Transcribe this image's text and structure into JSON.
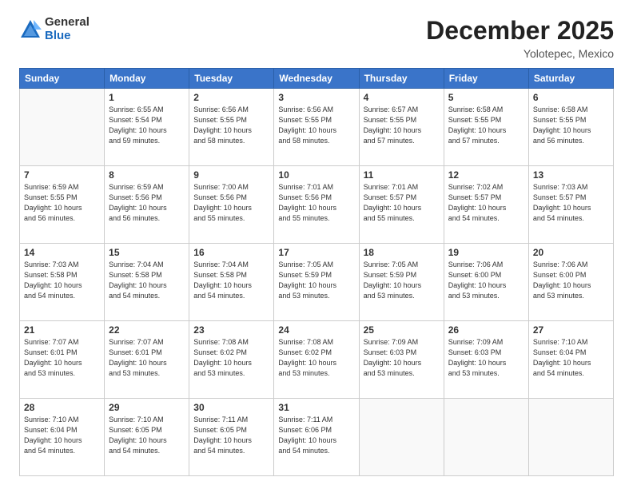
{
  "logo": {
    "general": "General",
    "blue": "Blue"
  },
  "title": "December 2025",
  "subtitle": "Yolotepec, Mexico",
  "weekdays": [
    "Sunday",
    "Monday",
    "Tuesday",
    "Wednesday",
    "Thursday",
    "Friday",
    "Saturday"
  ],
  "weeks": [
    [
      {
        "day": "",
        "info": ""
      },
      {
        "day": "1",
        "info": "Sunrise: 6:55 AM\nSunset: 5:54 PM\nDaylight: 10 hours\nand 59 minutes."
      },
      {
        "day": "2",
        "info": "Sunrise: 6:56 AM\nSunset: 5:55 PM\nDaylight: 10 hours\nand 58 minutes."
      },
      {
        "day": "3",
        "info": "Sunrise: 6:56 AM\nSunset: 5:55 PM\nDaylight: 10 hours\nand 58 minutes."
      },
      {
        "day": "4",
        "info": "Sunrise: 6:57 AM\nSunset: 5:55 PM\nDaylight: 10 hours\nand 57 minutes."
      },
      {
        "day": "5",
        "info": "Sunrise: 6:58 AM\nSunset: 5:55 PM\nDaylight: 10 hours\nand 57 minutes."
      },
      {
        "day": "6",
        "info": "Sunrise: 6:58 AM\nSunset: 5:55 PM\nDaylight: 10 hours\nand 56 minutes."
      }
    ],
    [
      {
        "day": "7",
        "info": "Sunrise: 6:59 AM\nSunset: 5:55 PM\nDaylight: 10 hours\nand 56 minutes."
      },
      {
        "day": "8",
        "info": "Sunrise: 6:59 AM\nSunset: 5:56 PM\nDaylight: 10 hours\nand 56 minutes."
      },
      {
        "day": "9",
        "info": "Sunrise: 7:00 AM\nSunset: 5:56 PM\nDaylight: 10 hours\nand 55 minutes."
      },
      {
        "day": "10",
        "info": "Sunrise: 7:01 AM\nSunset: 5:56 PM\nDaylight: 10 hours\nand 55 minutes."
      },
      {
        "day": "11",
        "info": "Sunrise: 7:01 AM\nSunset: 5:57 PM\nDaylight: 10 hours\nand 55 minutes."
      },
      {
        "day": "12",
        "info": "Sunrise: 7:02 AM\nSunset: 5:57 PM\nDaylight: 10 hours\nand 54 minutes."
      },
      {
        "day": "13",
        "info": "Sunrise: 7:03 AM\nSunset: 5:57 PM\nDaylight: 10 hours\nand 54 minutes."
      }
    ],
    [
      {
        "day": "14",
        "info": "Sunrise: 7:03 AM\nSunset: 5:58 PM\nDaylight: 10 hours\nand 54 minutes."
      },
      {
        "day": "15",
        "info": "Sunrise: 7:04 AM\nSunset: 5:58 PM\nDaylight: 10 hours\nand 54 minutes."
      },
      {
        "day": "16",
        "info": "Sunrise: 7:04 AM\nSunset: 5:58 PM\nDaylight: 10 hours\nand 54 minutes."
      },
      {
        "day": "17",
        "info": "Sunrise: 7:05 AM\nSunset: 5:59 PM\nDaylight: 10 hours\nand 53 minutes."
      },
      {
        "day": "18",
        "info": "Sunrise: 7:05 AM\nSunset: 5:59 PM\nDaylight: 10 hours\nand 53 minutes."
      },
      {
        "day": "19",
        "info": "Sunrise: 7:06 AM\nSunset: 6:00 PM\nDaylight: 10 hours\nand 53 minutes."
      },
      {
        "day": "20",
        "info": "Sunrise: 7:06 AM\nSunset: 6:00 PM\nDaylight: 10 hours\nand 53 minutes."
      }
    ],
    [
      {
        "day": "21",
        "info": "Sunrise: 7:07 AM\nSunset: 6:01 PM\nDaylight: 10 hours\nand 53 minutes."
      },
      {
        "day": "22",
        "info": "Sunrise: 7:07 AM\nSunset: 6:01 PM\nDaylight: 10 hours\nand 53 minutes."
      },
      {
        "day": "23",
        "info": "Sunrise: 7:08 AM\nSunset: 6:02 PM\nDaylight: 10 hours\nand 53 minutes."
      },
      {
        "day": "24",
        "info": "Sunrise: 7:08 AM\nSunset: 6:02 PM\nDaylight: 10 hours\nand 53 minutes."
      },
      {
        "day": "25",
        "info": "Sunrise: 7:09 AM\nSunset: 6:03 PM\nDaylight: 10 hours\nand 53 minutes."
      },
      {
        "day": "26",
        "info": "Sunrise: 7:09 AM\nSunset: 6:03 PM\nDaylight: 10 hours\nand 53 minutes."
      },
      {
        "day": "27",
        "info": "Sunrise: 7:10 AM\nSunset: 6:04 PM\nDaylight: 10 hours\nand 54 minutes."
      }
    ],
    [
      {
        "day": "28",
        "info": "Sunrise: 7:10 AM\nSunset: 6:04 PM\nDaylight: 10 hours\nand 54 minutes."
      },
      {
        "day": "29",
        "info": "Sunrise: 7:10 AM\nSunset: 6:05 PM\nDaylight: 10 hours\nand 54 minutes."
      },
      {
        "day": "30",
        "info": "Sunrise: 7:11 AM\nSunset: 6:05 PM\nDaylight: 10 hours\nand 54 minutes."
      },
      {
        "day": "31",
        "info": "Sunrise: 7:11 AM\nSunset: 6:06 PM\nDaylight: 10 hours\nand 54 minutes."
      },
      {
        "day": "",
        "info": ""
      },
      {
        "day": "",
        "info": ""
      },
      {
        "day": "",
        "info": ""
      }
    ]
  ]
}
